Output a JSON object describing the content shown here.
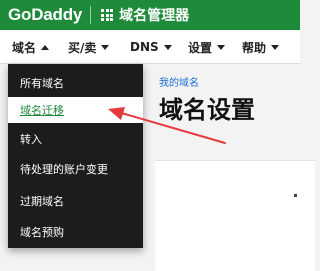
{
  "topbar": {
    "logo": "GoDaddy",
    "app_icon": "grid-icon",
    "title": "域名管理器",
    "color": "#1e8a3a"
  },
  "nav": {
    "items": [
      {
        "label": "域名",
        "caret": "up"
      },
      {
        "label": "买/卖",
        "caret": "down"
      },
      {
        "label": "DNS",
        "caret": "down"
      },
      {
        "label": "设置",
        "caret": "down"
      },
      {
        "label": "帮助",
        "caret": "down"
      }
    ]
  },
  "dropdown": {
    "items": [
      {
        "label": "所有域名"
      },
      {
        "label": "域名迁移",
        "active": true
      },
      {
        "label": "转入"
      },
      {
        "label": "待处理的账户变更"
      },
      {
        "label": "过期域名"
      },
      {
        "label": "域名预购"
      }
    ]
  },
  "main": {
    "breadcrumb": "我的域名",
    "title": "域名设置"
  },
  "annotation": {
    "arrow_color": "#e8383d"
  }
}
